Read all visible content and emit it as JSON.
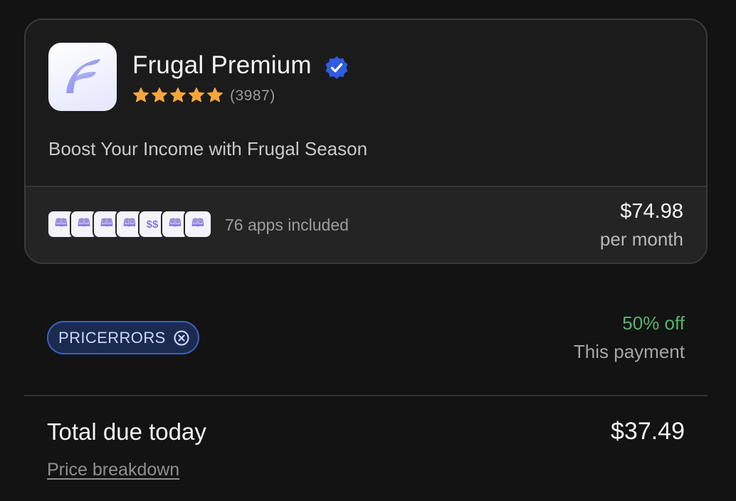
{
  "product": {
    "name": "Frugal Premium",
    "rating_count": "(3987)",
    "stars": 5,
    "tagline": "Boost Your Income with Frugal Season"
  },
  "bundle": {
    "apps_included": "76 apps included",
    "price": "$74.98",
    "period": "per month"
  },
  "coupon": {
    "code": "PRICERRORS",
    "discount": "50% off",
    "discount_note": "This payment"
  },
  "total": {
    "label": "Total due today",
    "amount": "$37.49",
    "breakdown_link": "Price breakdown"
  },
  "colors": {
    "accent_blue": "#3b5fbe",
    "discount_green": "#55b36a",
    "star_orange": "#f5a63b",
    "verified_blue": "#2f5be0"
  },
  "icons": {
    "app_logo": "frugal-f-logo",
    "verified": "verified-badge-icon",
    "stars": "star-icon",
    "coupon_remove": "circle-x-icon"
  }
}
